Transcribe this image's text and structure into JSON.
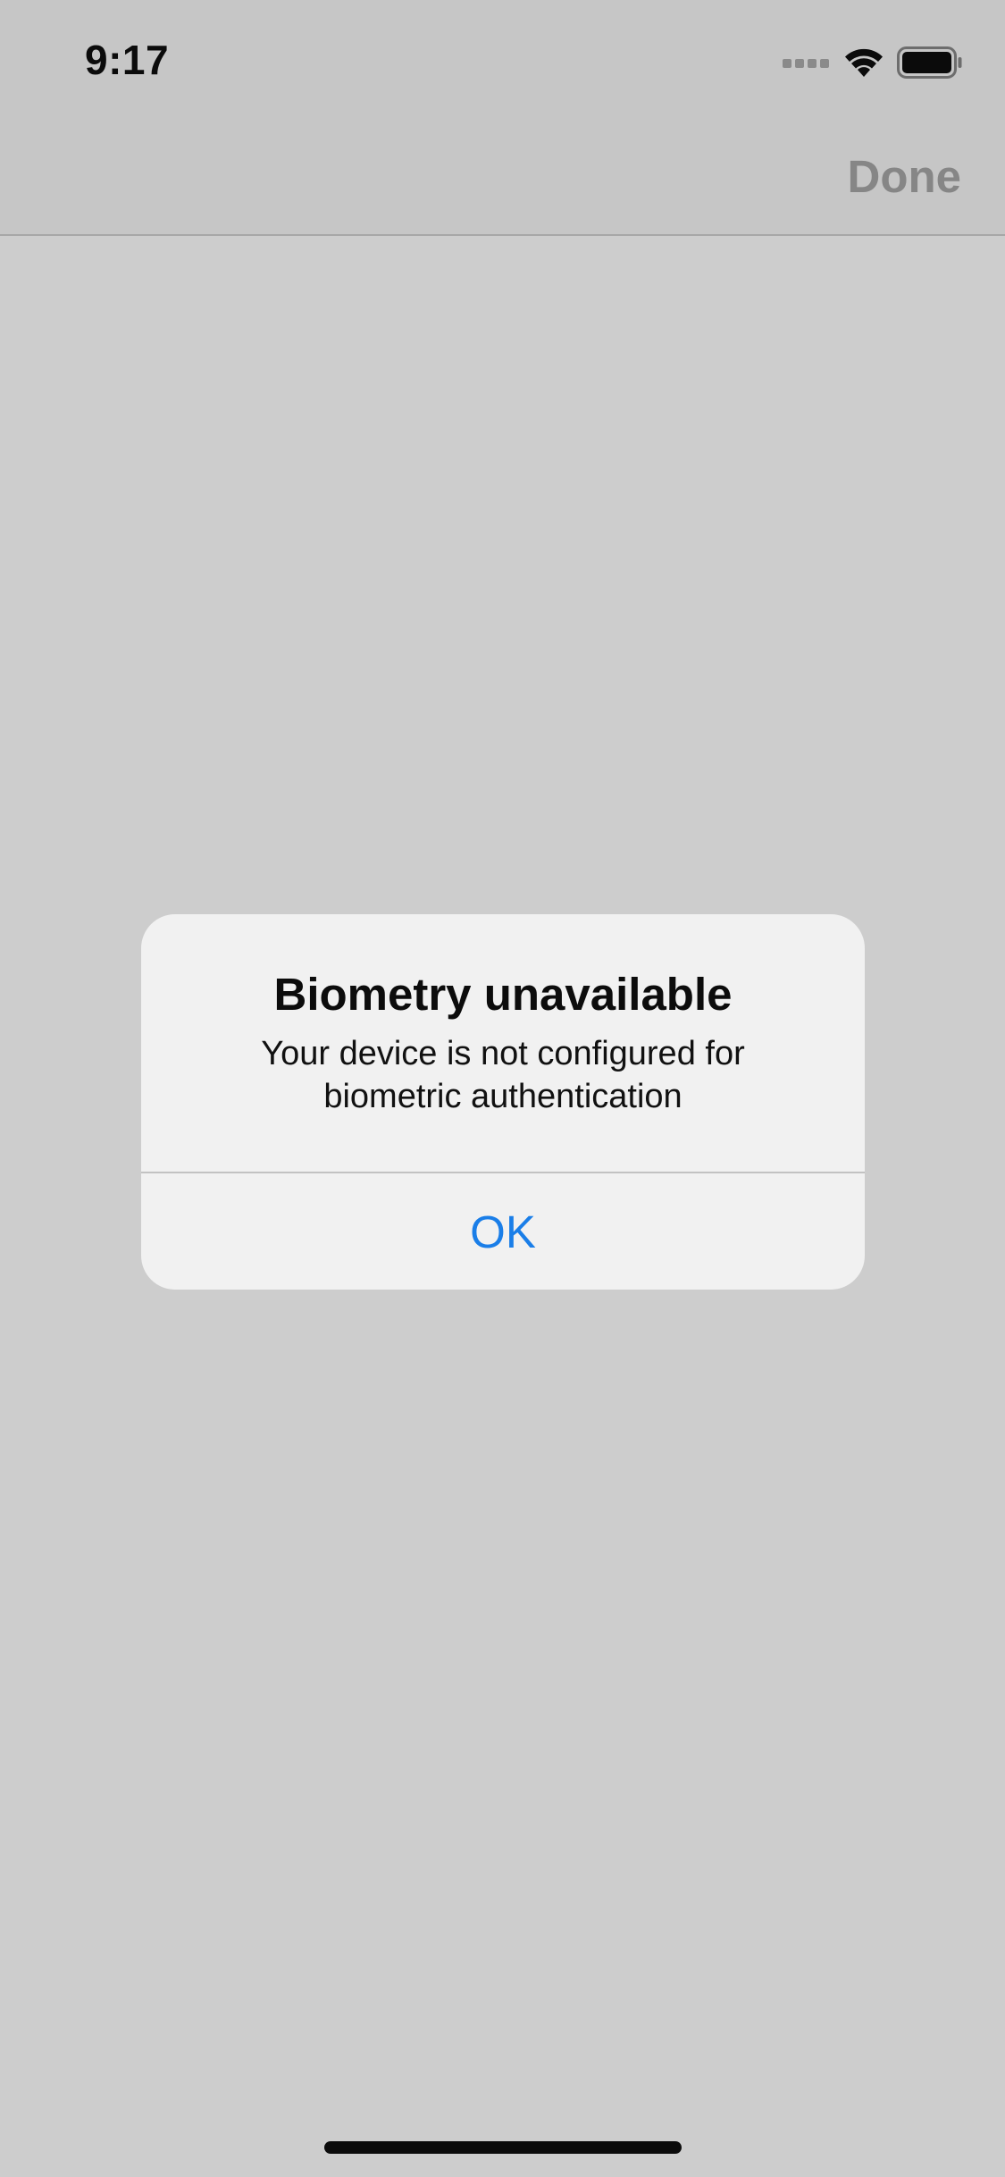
{
  "status_bar": {
    "time": "9:17",
    "icons": [
      "cellular-signal-icon",
      "wifi-icon",
      "battery-icon"
    ]
  },
  "nav_bar": {
    "done_label": "Done"
  },
  "alert": {
    "title": "Biometry unavailable",
    "message": "Your device is not configured for biometric authentication",
    "ok_label": "OK"
  },
  "colors": {
    "accent": "#1a7ee8",
    "dimmed_overlay": "#cdcdcd",
    "alert_background": "#f1f1f1",
    "done_disabled": "#868686"
  }
}
